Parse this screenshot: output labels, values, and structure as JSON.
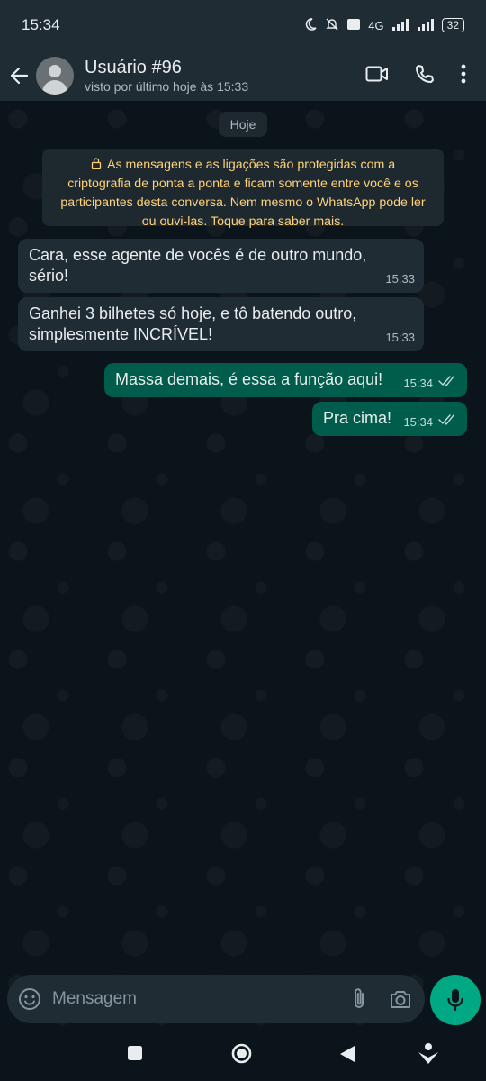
{
  "status_bar": {
    "time": "15:34",
    "network_label": "4G",
    "battery": "32"
  },
  "header": {
    "contact_name": "Usuário #96",
    "last_seen": "visto por último hoje às 15:33"
  },
  "chat": {
    "date_chip": "Hoje",
    "encryption_notice": "As mensagens e as ligações são protegidas com a criptografia de ponta a ponta e ficam somente entre você e os participantes desta conversa. Nem mesmo o WhatsApp pode ler ou ouvi-las. Toque para saber mais.",
    "messages": [
      {
        "direction": "in",
        "text_line1": "Cara, esse agente de vocês é de outro mundo,",
        "text_line2": "sério!",
        "time": "15:33"
      },
      {
        "direction": "in",
        "text_line1": "Ganhei 3 bilhetes só hoje, e tô batendo outro,",
        "text_line2": "simplesmente INCRÍVEL!",
        "time": "15:33"
      },
      {
        "direction": "out",
        "text": "Massa demais, é essa a função aqui!",
        "time": "15:34",
        "status": "read"
      },
      {
        "direction": "out",
        "text": "Pra cima!",
        "time": "15:34",
        "status": "read"
      }
    ]
  },
  "composer": {
    "placeholder": "Mensagem"
  },
  "colors": {
    "background": "#0b141a",
    "header": "#1f2c34",
    "incoming_bubble": "#202c33",
    "outgoing_bubble": "#005c4b",
    "accent": "#00a884",
    "notice_text": "#ffd279"
  },
  "icons": [
    "back-arrow-icon",
    "video-call-icon",
    "voice-call-icon",
    "more-options-icon",
    "lock-icon",
    "emoji-icon",
    "attach-icon",
    "camera-icon",
    "mic-icon",
    "double-check-icon"
  ]
}
